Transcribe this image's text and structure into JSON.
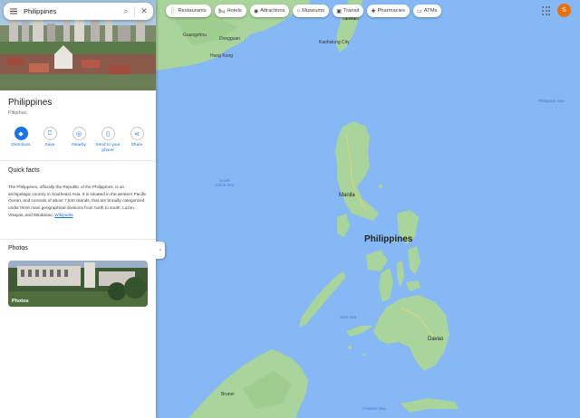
{
  "search": {
    "value": "Philippines",
    "menu_icon": "hamburger-menu-icon",
    "search_icon": "magnifier-icon",
    "close_icon": "close-icon"
  },
  "place": {
    "title": "Philippines",
    "subtitle": "Pilipinas"
  },
  "actions": [
    {
      "label": "Directions",
      "icon": "directions-icon"
    },
    {
      "label": "Save",
      "icon": "bookmark-icon"
    },
    {
      "label": "Nearby",
      "icon": "nearby-icon"
    },
    {
      "label": "Send to your phone",
      "icon": "phone-icon"
    },
    {
      "label": "Share",
      "icon": "share-icon"
    }
  ],
  "quick_facts": {
    "title": "Quick facts",
    "text": "The Philippines, officially the Republic of the Philippines, is an archipelagic country in Southeast Asia. It is situated in the western Pacific Ocean, and consists of about 7,640 islands, that are broadly categorized under three main geographical divisions from north to south: Luzon, Visayas, and Mindanao.",
    "link": "Wikipedia"
  },
  "photos": {
    "title": "Photos",
    "thumb_label": "Photos"
  },
  "chips": [
    {
      "label": "Restaurants",
      "icon": "fork-knife-icon"
    },
    {
      "label": "Hotels",
      "icon": "bed-icon"
    },
    {
      "label": "Attractions",
      "icon": "camera-icon"
    },
    {
      "label": "Museums",
      "icon": "museum-icon"
    },
    {
      "label": "Transit",
      "icon": "train-icon"
    },
    {
      "label": "Pharmacies",
      "icon": "pill-icon"
    },
    {
      "label": "ATMs",
      "icon": "atm-icon"
    }
  ],
  "user": {
    "avatar_letter": "S",
    "avatar_color": "#e8710a"
  },
  "map_labels": {
    "philippines": "Philippines",
    "taiwan": "Taiwan",
    "kaohsiung": "Kaohsiung City",
    "guangzhou": "Guangzhou",
    "dongguan": "Dongguan",
    "hong_kong": "Hong Kong",
    "manila": "Manila",
    "davao": "Davao",
    "brunei": "Brunei",
    "south_china_sea": "South China Sea",
    "philippine_sea": "Philippine Sea",
    "sulu_sea": "Sulu Sea",
    "celebes_sea": "Celebes Sea"
  },
  "colors": {
    "water": "#85b8f5",
    "land": "#a8d89b",
    "accent": "#1a73e8"
  }
}
